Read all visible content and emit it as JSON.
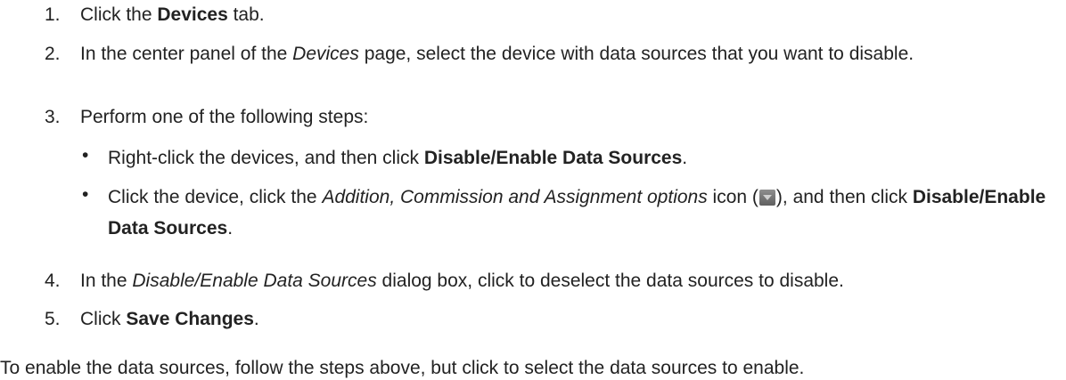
{
  "steps": [
    {
      "number": "1.",
      "parts": [
        "Click the ",
        "Devices",
        " tab."
      ]
    },
    {
      "number": "2.",
      "parts": [
        "In the center panel of the ",
        "Devices",
        " page, select the device with data sources that you want to disable."
      ]
    },
    {
      "number": "3.",
      "parts": [
        "Perform one of the following steps:"
      ],
      "substeps": [
        {
          "bullet": "•",
          "parts": [
            "Right-click the devices, and then click ",
            "Disable/Enable Data Sources",
            "."
          ]
        },
        {
          "bullet": "•",
          "parts": [
            "Click the device, click the ",
            "Addition, Commission and Assignment options",
            " icon (",
            "), and then click ",
            "Disable/Enable Data Sources",
            "."
          ],
          "icon": "dropdown-arrow-icon"
        }
      ]
    },
    {
      "number": "4.",
      "parts": [
        "In the ",
        "Disable/Enable Data Sources",
        " dialog box, click to deselect the data sources to disable."
      ]
    },
    {
      "number": "5.",
      "parts": [
        "Click ",
        "Save Changes",
        "."
      ]
    }
  ],
  "note": "To enable the data sources, follow the steps above, but click to select the data sources to enable.",
  "colors": {
    "text": "#222222",
    "icon_background": "#6f6f6f",
    "icon_arrow": "#cfcfcf"
  }
}
